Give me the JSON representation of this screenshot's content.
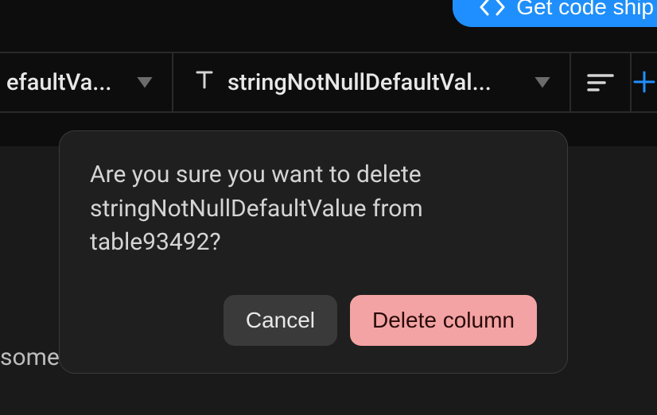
{
  "header": {
    "get_code_label": "Get code ship"
  },
  "columns": {
    "col0": {
      "label": "efaultVa..."
    },
    "col1": {
      "label": "stringNotNullDefaultVal..."
    }
  },
  "background": {
    "partial_text": "some"
  },
  "modal": {
    "message": "Are you sure you want to delete stringNotNullDefaultValue from table93492?",
    "cancel_label": "Cancel",
    "delete_label": "Delete column"
  }
}
